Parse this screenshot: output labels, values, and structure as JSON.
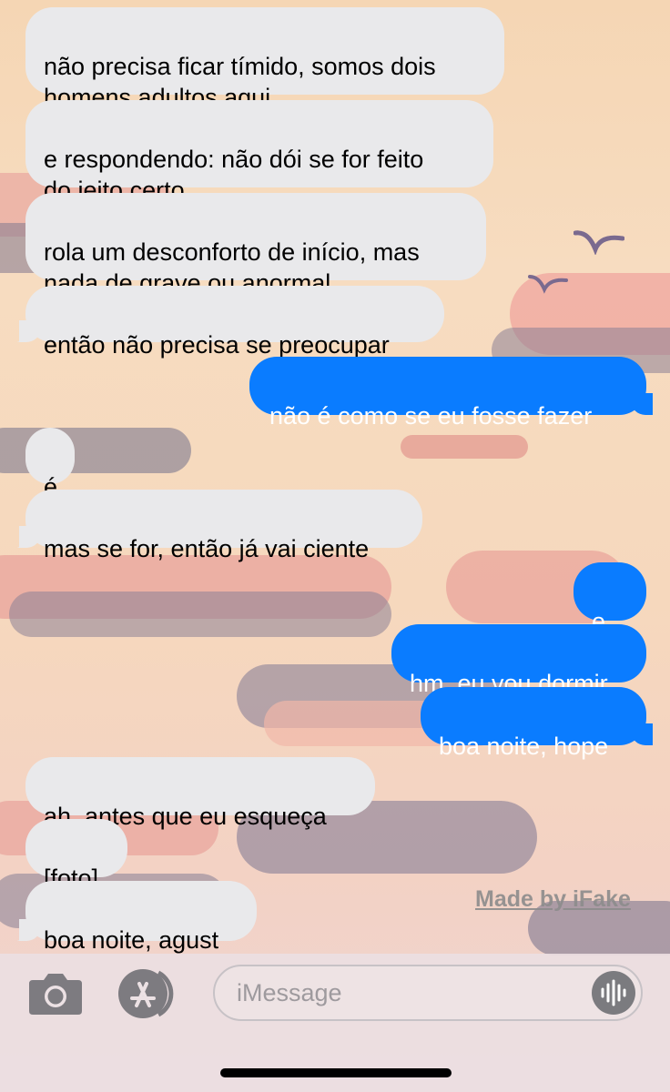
{
  "messages": [
    {
      "side": "received",
      "text": "não precisa ficar tímido, somos dois\nhomens adultos aqui"
    },
    {
      "side": "received",
      "text": "e respondendo: não dói se for feito\ndo jeito certo"
    },
    {
      "side": "received",
      "text": "rola um desconforto de início, mas\nnada de grave ou anormal"
    },
    {
      "side": "received",
      "text": "então não precisa se preocupar"
    },
    {
      "side": "sent",
      "text": "não é como se eu fosse fazer"
    },
    {
      "side": "received",
      "text": "é"
    },
    {
      "side": "received",
      "text": "mas se for, então já vai ciente"
    },
    {
      "side": "sent",
      "text": "e..."
    },
    {
      "side": "sent",
      "text": "hm, eu vou dormir"
    },
    {
      "side": "sent",
      "text": "boa noite, hope"
    },
    {
      "side": "received",
      "text": "ah, antes que eu esqueça"
    },
    {
      "side": "received",
      "text": "[foto]"
    },
    {
      "side": "received",
      "text": "boa noite, agust"
    }
  ],
  "watermark": "Made by iFake",
  "input": {
    "placeholder": "iMessage"
  },
  "icons": {
    "camera": "camera-icon",
    "apps": "app-store-icon",
    "audio": "audio-waveform-icon"
  },
  "colors": {
    "sent_bubble": "#0a7cff",
    "received_bubble": "#e9e9eb",
    "background_top": "#f5d6b4",
    "background_bottom": "#eed4d2"
  }
}
